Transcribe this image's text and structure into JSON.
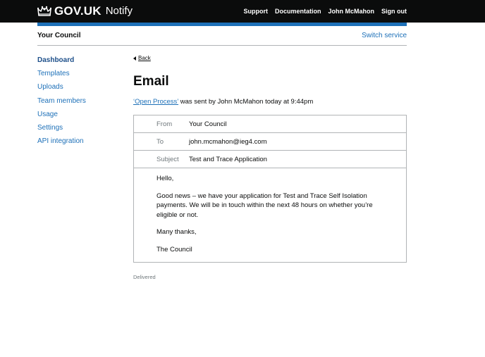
{
  "header": {
    "logo_text": "GOV.UK",
    "product": "Notify",
    "nav": [
      "Support",
      "Documentation",
      "John McMahon",
      "Sign out"
    ]
  },
  "service": {
    "name": "Your Council",
    "switch_label": "Switch service"
  },
  "sidebar": {
    "items": [
      {
        "label": "Dashboard"
      },
      {
        "label": "Templates"
      },
      {
        "label": "Uploads"
      },
      {
        "label": "Team members"
      },
      {
        "label": "Usage"
      },
      {
        "label": "Settings"
      },
      {
        "label": "API integration"
      }
    ]
  },
  "main": {
    "back_label": "Back",
    "title": "Email",
    "template_link": "‘Open Process’",
    "sent_text": " was sent by John McMahon today at 9:44pm",
    "email": {
      "from_label": "From",
      "from_value": "Your Council",
      "to_label": "To",
      "to_value": "john.mcmahon@ieg4.com",
      "subject_label": "Subject",
      "subject_value": "Test and Trace Application",
      "body": [
        "Hello,",
        "Good news – we have your application for Test and Trace Self Isolation payments. We will be in touch within the next 48 hours on whether you’re eligible or not.",
        "Many thanks,",
        "The Council"
      ]
    },
    "status": "Delivered"
  },
  "colors": {
    "header_bg": "#0b0c0c",
    "accent_blue": "#1d70b8",
    "border": "#b1b4b6",
    "secondary_text": "#6f777b"
  }
}
